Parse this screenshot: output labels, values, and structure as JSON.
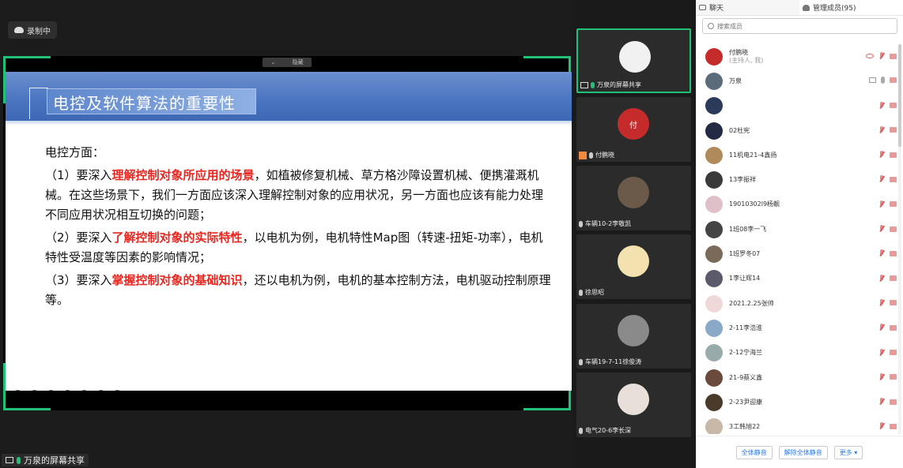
{
  "recording": {
    "label": "录制中"
  },
  "share": {
    "toggle_label": "隐藏",
    "bottom_label": "万泉的屏幕共享"
  },
  "slide": {
    "title": "电控及软件算法的重要性",
    "heading": "电控方面：",
    "items": [
      {
        "prefix": "（1）要深入",
        "highlight": "理解控制对象所应用的场景",
        "rest": "，如植被修复机械、草方格沙障设置机械、便携灌溉机械。在这些场景下，我们一方面应该深入理解控制对象的应用状况，另一方面也应该有能力处理不同应用状况相互切换的问题；"
      },
      {
        "prefix": "（2）要深入",
        "highlight": "了解控制对象的实际特性",
        "rest": "，以电机为例，电机特性Map图（转速-扭矩-功率），电机特性受温度等因素的影响情况；"
      },
      {
        "prefix": "（3）要深入",
        "highlight": "掌握控制对象的基础知识",
        "rest": "，还以电机为例，电机的基本控制方法，电机驱动控制原理等。"
      }
    ]
  },
  "video_tiles": [
    {
      "name": "万泉的屏幕共享",
      "color": "#f1f1f1",
      "avatar_text": "",
      "active": true
    },
    {
      "name": "付鹏晓",
      "color": "#c62b2b",
      "avatar_text": "付",
      "active": false
    },
    {
      "name": "车辆10-2李敬凯",
      "color": "#6b5a4a",
      "avatar_text": "",
      "active": false
    },
    {
      "name": "徐思昭",
      "color": "#f3e2b0",
      "avatar_text": "",
      "active": false
    },
    {
      "name": "车辆19-7-11徐俊涛",
      "color": "#8a8a8a",
      "avatar_text": "",
      "active": false
    },
    {
      "name": "电气20-6李长深",
      "color": "#e8e0d8",
      "avatar_text": "",
      "active": false
    }
  ],
  "panel": {
    "tab_chat": "聊天",
    "tab_members": "管理成员(95)",
    "search_placeholder": "搜索成员",
    "members": [
      {
        "name": "付鹏晓",
        "sub": "(主持人, 我)",
        "color": "#c62b2b"
      },
      {
        "name": "万泉",
        "sub": "",
        "color": "#5b6b7a"
      },
      {
        "name": "",
        "sub": "",
        "color": "#2c3a5a"
      },
      {
        "name": "02杜宪",
        "sub": "",
        "color": "#222a44"
      },
      {
        "name": "11机电21-4鑫扬",
        "sub": "",
        "color": "#b08a5a"
      },
      {
        "name": "13李振祥",
        "sub": "",
        "color": "#3a3a3a"
      },
      {
        "name": "19010302l9杨靓",
        "sub": "",
        "color": "#e0c0c8"
      },
      {
        "name": "1班08李一飞",
        "sub": "",
        "color": "#444"
      },
      {
        "name": "1班罗冬07",
        "sub": "",
        "color": "#7a6a5a"
      },
      {
        "name": "1李让辉14",
        "sub": "",
        "color": "#5a5a6a"
      },
      {
        "name": "2021.2.25张帅",
        "sub": "",
        "color": "#f0d8d8"
      },
      {
        "name": "2-11李浩淮",
        "sub": "",
        "color": "#8aa8c8"
      },
      {
        "name": "2-12宁海兰",
        "sub": "",
        "color": "#9aa"
      },
      {
        "name": "21-9蔡义鑫",
        "sub": "",
        "color": "#6a4a3a"
      },
      {
        "name": "2-23尹迎康",
        "sub": "",
        "color": "#4a3a2a"
      },
      {
        "name": "3工韩旭22",
        "sub": "",
        "color": "#c8b8a8"
      }
    ],
    "btn_mute_all": "全体静音",
    "btn_unmute_all": "解除全体静音",
    "btn_more": "更多 ▾"
  }
}
